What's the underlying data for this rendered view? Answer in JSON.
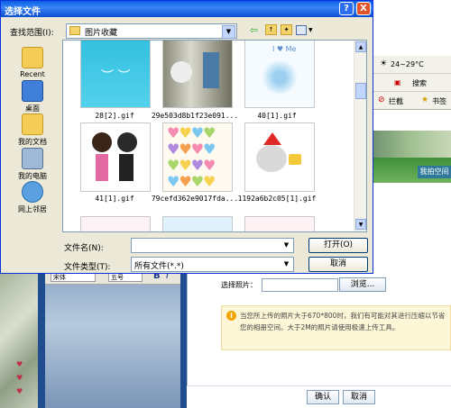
{
  "dialog": {
    "title": "选择文件",
    "help_label": "?",
    "close_label": "X",
    "look_in_label": "查找范围(I):",
    "look_in_value": "图片收藏",
    "places": [
      {
        "label": "Recent",
        "icon": "recent-folder-icon"
      },
      {
        "label": "桌面",
        "icon": "desktop-icon"
      },
      {
        "label": "我的文档",
        "icon": "my-documents-icon"
      },
      {
        "label": "我的电脑",
        "icon": "my-computer-icon"
      },
      {
        "label": "网上邻居",
        "icon": "network-places-icon"
      }
    ],
    "files": [
      {
        "name": "28[2].gif"
      },
      {
        "name": "29e503d8b1f23e091..."
      },
      {
        "name": "40[1].gif"
      },
      {
        "name": "41[1].gif"
      },
      {
        "name": "79cefd362e9017fda..."
      },
      {
        "name": "1192a6b2c05[1].gif"
      }
    ],
    "filename_label": "文件名(N):",
    "filename_value": "",
    "filetype_label": "文件类型(T):",
    "filetype_value": "所有文件(*.*)",
    "open_label": "打开(O)",
    "cancel_label": "取消"
  },
  "background": {
    "weather": "24~29°C",
    "search_label": "搜索",
    "intercept_label": "拦截",
    "bookmark_label": "书签",
    "upload_label": "我拍空间",
    "font_value": "宋体",
    "size_value": "五号",
    "bold_label": "B",
    "italic_label": "I",
    "select_photo_label": "选择照片：",
    "browse_label": "浏览...",
    "info_text": "当您所上传的照片大于670*800时，我们有可能对其进行压缩以节省您的相册空间。大于2M的照片请使用极速上传工具。",
    "ok_label": "确认",
    "cancel_label": "取消"
  }
}
